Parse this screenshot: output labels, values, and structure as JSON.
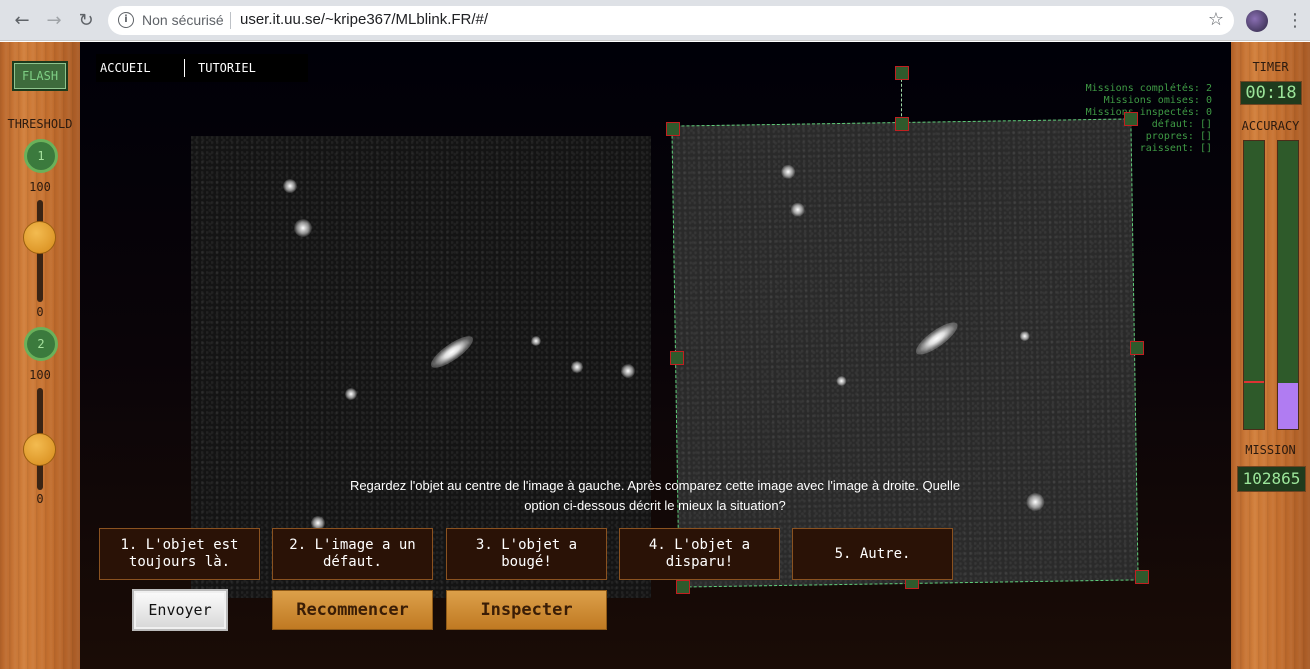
{
  "browser": {
    "security_text": "Non sécurisé",
    "url": "user.it.uu.se/~kripe367/MLblink.FR/#/"
  },
  "left_panel": {
    "flash_label": "FLASH",
    "threshold_label": "THRESHOLD",
    "slider1": {
      "number": "1",
      "max_label": "100",
      "min_label": "0"
    },
    "slider2": {
      "number": "2",
      "max_label": "100",
      "min_label": "0"
    }
  },
  "right_panel": {
    "timer_label": "TIMER",
    "timer_value": "00:18",
    "accuracy_label": "ACCURACY",
    "accuracy_bar_right_fill": 0.16,
    "mission_label": "MISSION",
    "mission_value": "102865"
  },
  "nav": {
    "home": "ACCUEIL",
    "tutorial": "TUTORIEL"
  },
  "stats": [
    "Missions complétés: 2",
    "Missions omises: 0",
    "Missions inspectés: 0",
    "défaut: []",
    "propres: []",
    "raissent: []"
  ],
  "question": {
    "line1": "Regardez l'objet au centre de l'image à gauche. Après comparez cette image avec l'image à droite. Quelle",
    "line2": "option ci-dessous décrit le mieux la situation?"
  },
  "options": [
    {
      "line1": "1. L'objet est",
      "line2": "toujours là."
    },
    {
      "line1": "2. L'image a un",
      "line2": "défaut."
    },
    {
      "line1": "3. L'objet a",
      "line2": "bougé!"
    },
    {
      "line1": "4. L'objet a",
      "line2": "disparu!"
    },
    {
      "line1": "5. Autre.",
      "line2": ""
    }
  ],
  "buttons": {
    "send": "Envoyer",
    "restart": "Recommencer",
    "inspect": "Inspecter"
  },
  "colors": {
    "wood": "#c46f2e",
    "lcd_bg": "#1f3b1d",
    "lcd_text": "#9ce59a",
    "accuracy_fill": "#b07cf2"
  }
}
